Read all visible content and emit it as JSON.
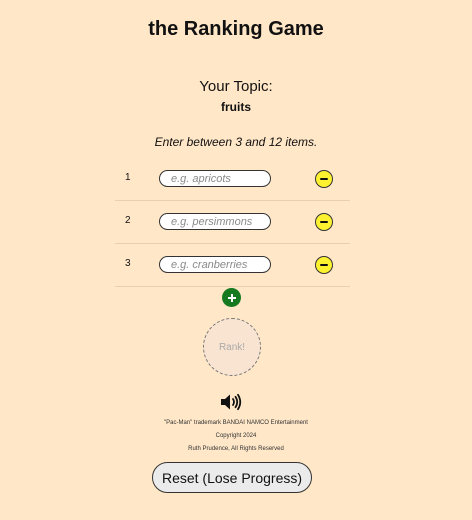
{
  "header": {
    "title": "the Ranking Game"
  },
  "topic": {
    "label": "Your Topic:",
    "value": "fruits"
  },
  "instructions": "Enter between 3 and 12 items.",
  "items": [
    {
      "number": "1",
      "value": "",
      "placeholder": "e.g. apricots"
    },
    {
      "number": "2",
      "value": "",
      "placeholder": "e.g. persimmons"
    },
    {
      "number": "3",
      "value": "",
      "placeholder": "e.g. cranberries"
    }
  ],
  "controls": {
    "remove_icon": "minus-icon",
    "add_icon": "plus-icon",
    "rank_label": "Rank!",
    "sound_icon": "speaker-icon",
    "reset_label": "Reset (Lose Progress)"
  },
  "footer": {
    "trademark": "\"Pac-Man\" trademark BANDAI NAMCO Entertainment",
    "copyright": "Copyright 2024",
    "rights": "Ruth Prudence, All Rights Reserved"
  },
  "colors": {
    "background": "#ffe7c8",
    "remove_button": "#fdf22f",
    "add_button": "#157a1f",
    "rank_button": "#f9e4d1",
    "reset_button": "#ebebeb"
  }
}
